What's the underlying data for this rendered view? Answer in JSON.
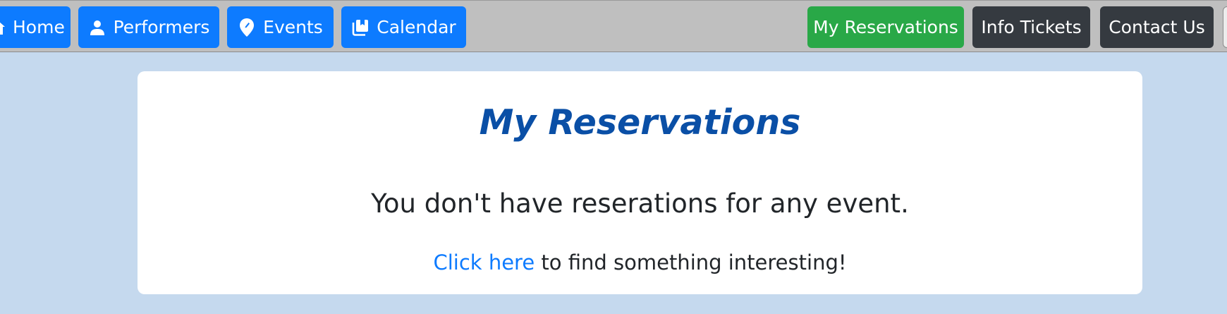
{
  "nav": {
    "home_label": "Home",
    "performers_label": "Performers",
    "events_label": "Events",
    "calendar_label": "Calendar",
    "reservations_label": "My Reservations",
    "info_tickets_label": "Info Tickets",
    "contact_label": "Contact Us"
  },
  "main": {
    "title": "My Reservations",
    "empty_message": "You don't have reserations for any event.",
    "cta_link": "Click here",
    "cta_rest": " to find something interesting!"
  },
  "colors": {
    "nav_background": "#bfbfbf",
    "page_background": "#c5d9ee",
    "primary_blue": "#0d7bff",
    "success_green": "#29a847",
    "dark": "#353a40",
    "title_blue": "#0a4fa6"
  },
  "icons": [
    "home-icon",
    "person-icon",
    "map-pin-icon",
    "calendar-pages-icon"
  ]
}
